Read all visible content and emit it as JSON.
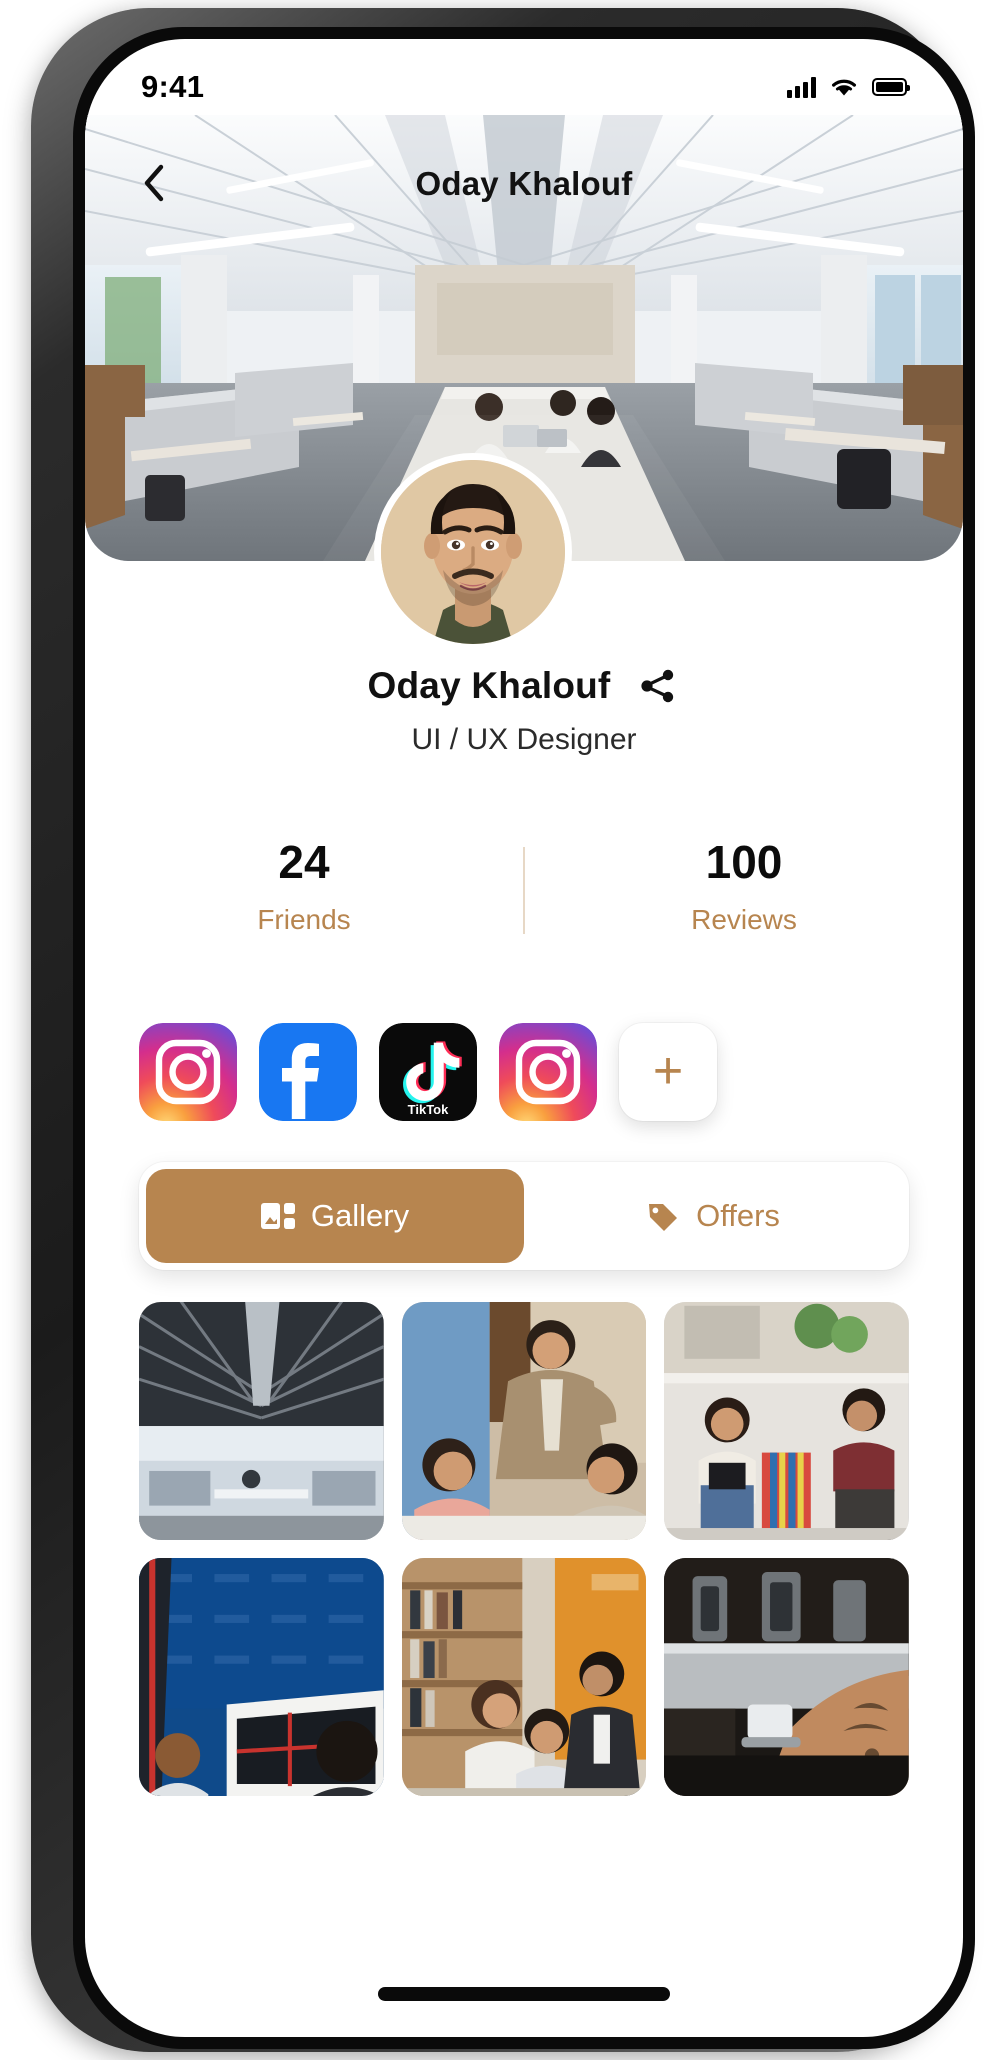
{
  "status_bar": {
    "time": "9:41",
    "cellular_icon": "signal-bars-icon",
    "wifi_icon": "wifi-icon",
    "battery_icon": "battery-full-icon"
  },
  "nav": {
    "back_icon": "chevron-left-icon",
    "title": "Oday Khalouf"
  },
  "cover": {
    "alt": "open-plan modern office with desks and people working"
  },
  "profile": {
    "avatar_alt": "portrait photo of a young man",
    "name": "Oday Khalouf",
    "role": "UI / UX Designer",
    "share_icon": "share-icon"
  },
  "stats": [
    {
      "value": "24",
      "label": "Friends"
    },
    {
      "value": "100",
      "label": "Reviews"
    }
  ],
  "socials": [
    {
      "name": "Instagram",
      "icon": "instagram-icon"
    },
    {
      "name": "Facebook",
      "icon": "facebook-icon"
    },
    {
      "name": "TikTok",
      "icon": "tiktok-icon",
      "wordmark": "TikTok"
    },
    {
      "name": "Instagram",
      "icon": "instagram-icon"
    }
  ],
  "add_social": {
    "label": "+",
    "icon": "plus-icon"
  },
  "tabs": [
    {
      "label": "Gallery",
      "icon": "gallery-grid-icon",
      "active": true
    },
    {
      "label": "Offers",
      "icon": "tag-icon",
      "active": false
    }
  ],
  "gallery": [
    {
      "alt": "office ceiling ducts above workstations"
    },
    {
      "alt": "man in blazer presenting to seated colleagues"
    },
    {
      "alt": "people on a rooftop terrace with laptops"
    },
    {
      "alt": "two people outdoors against a deep blue wall"
    },
    {
      "alt": "team meeting in a library style office"
    },
    {
      "alt": "barista making coffee at an espresso machine"
    }
  ],
  "colors": {
    "accent": "#b7854f",
    "accent_text": "#b7854f",
    "divider": "#e7d8c6",
    "screen_bg": "#ffffff"
  },
  "home_indicator": {
    "name": "home-indicator"
  }
}
